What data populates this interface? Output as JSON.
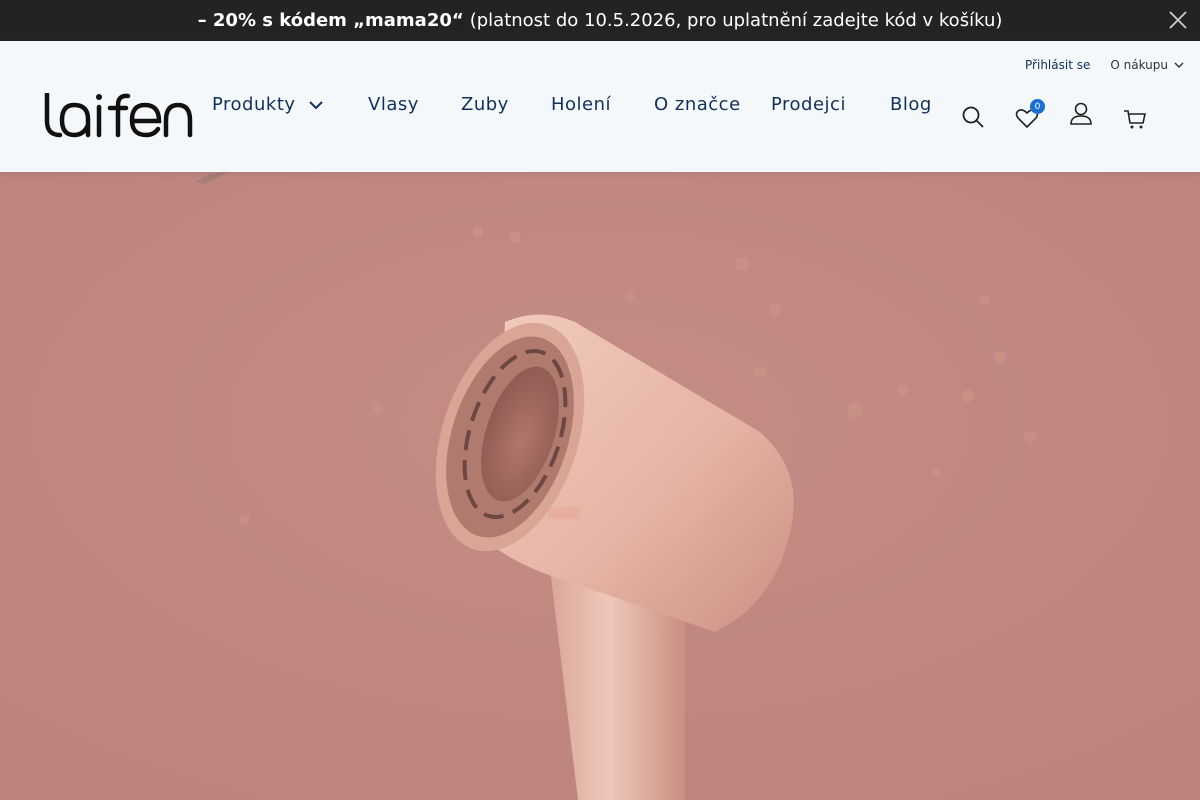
{
  "promo": {
    "strong": "– 20% s kódem „mama20“",
    "rest": "(platnost do 10.5.2026, pro uplatnění zadejte kód v košíku)"
  },
  "header": {
    "brand": "laifen",
    "top_links": {
      "login": "Přihlásit se",
      "about_shopping": "O nákupu"
    },
    "nav": {
      "produkty": "Produkty",
      "vlasy": "Vlasy",
      "zuby": "Zuby",
      "holeni": "Holení",
      "o_znacce": "O značce",
      "prodejci": "Prodejci",
      "blog": "Blog"
    },
    "wishlist_count": "0"
  },
  "colors": {
    "promo_bg": "#232323",
    "header_bg": "#f4f8fa",
    "nav_text": "#12305c",
    "hero_bg": "#bf8680",
    "badge": "#1a6fd3"
  },
  "icons": [
    "close-icon",
    "chevron-down-icon",
    "search-icon",
    "heart-icon",
    "user-icon",
    "cart-icon"
  ]
}
